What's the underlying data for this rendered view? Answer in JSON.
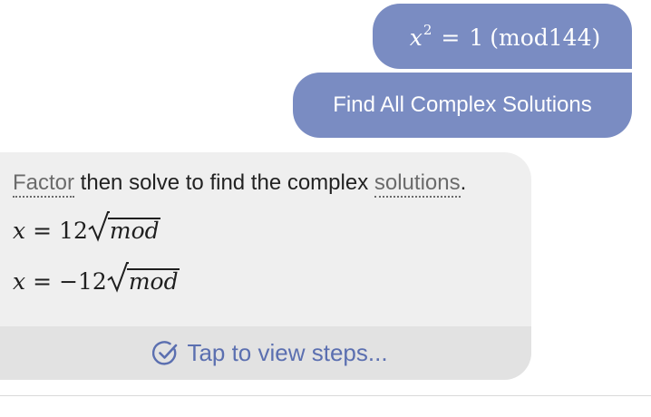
{
  "query": {
    "equation": {
      "variable": "x",
      "exponent": "2",
      "equals": "=",
      "value": "1",
      "open_paren": "(",
      "mod_expr": "mod144",
      "close_paren": ")"
    },
    "action_label": "Find All Complex Solutions"
  },
  "answer": {
    "factor_link": "Factor",
    "text_mid": " then solve to find the complex ",
    "solutions_link": "solutions",
    "text_end": ".",
    "solutions": [
      {
        "variable": "x",
        "equals": "=",
        "sign": "",
        "coefficient": "12",
        "radicand": "mod"
      },
      {
        "variable": "x",
        "equals": "=",
        "sign": "−",
        "coefficient": "12",
        "radicand": "mod"
      }
    ],
    "steps_label": "Tap to view steps..."
  },
  "colors": {
    "user_bubble": "#7a8cc2",
    "card_background": "#efefef",
    "steps_bar": "#e2e2e2",
    "accent": "#5b6fb0"
  },
  "icons": {
    "steps": "check-circle-icon"
  }
}
